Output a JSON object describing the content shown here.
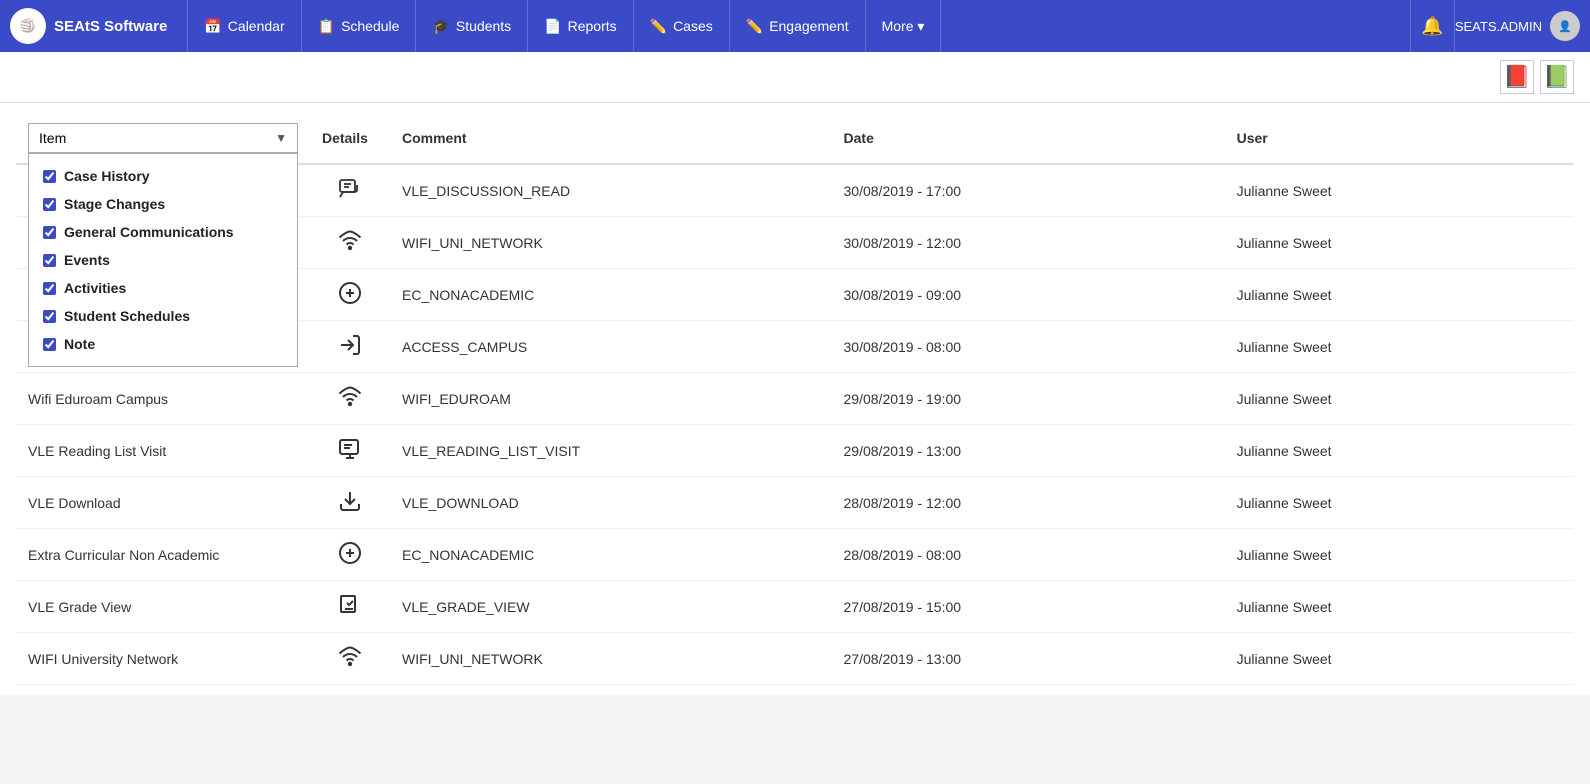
{
  "brand": {
    "logo_text": "SEAtS",
    "name": "SEAtS Software"
  },
  "nav": {
    "items": [
      {
        "label": "Calendar",
        "icon": "📅"
      },
      {
        "label": "Schedule",
        "icon": "📋"
      },
      {
        "label": "Students",
        "icon": "🎓"
      },
      {
        "label": "Reports",
        "icon": "📄"
      },
      {
        "label": "Cases",
        "icon": "✏️"
      },
      {
        "label": "Engagement",
        "icon": "✏️"
      },
      {
        "label": "More ▾",
        "icon": ""
      }
    ],
    "admin_label": "SEATS.ADMIN"
  },
  "toolbar": {
    "pdf_label": "PDF",
    "excel_label": "XLS"
  },
  "table": {
    "columns": {
      "item": "Item",
      "details": "Details",
      "comment": "Comment",
      "date": "Date",
      "user": "User"
    },
    "dropdown": {
      "label": "Item",
      "options": [
        {
          "label": "Case History",
          "checked": true
        },
        {
          "label": "Stage Changes",
          "checked": true
        },
        {
          "label": "General Communications",
          "checked": true
        },
        {
          "label": "Events",
          "checked": true
        },
        {
          "label": "Activities",
          "checked": true
        },
        {
          "label": "Student Schedules",
          "checked": true
        },
        {
          "label": "Note",
          "checked": true
        }
      ]
    },
    "rows": [
      {
        "item": "",
        "icon": "💬",
        "icon_name": "discussion-icon",
        "comment": "VLE_DISCUSSION_READ",
        "date": "30/08/2019 - 17:00",
        "user": "Julianne Sweet"
      },
      {
        "item": "",
        "icon": "📶",
        "icon_name": "wifi-icon",
        "comment": "WIFI_UNI_NETWORK",
        "date": "30/08/2019 - 12:00",
        "user": "Julianne Sweet"
      },
      {
        "item": "",
        "icon": "⊕",
        "icon_name": "add-circle-icon",
        "comment": "EC_NONACADEMIC",
        "date": "30/08/2019 - 09:00",
        "user": "Julianne Sweet"
      },
      {
        "item": "",
        "icon": "🚪",
        "icon_name": "access-icon",
        "comment": "ACCESS_CAMPUS",
        "date": "30/08/2019 - 08:00",
        "user": "Julianne Sweet"
      },
      {
        "item": "Wifi Eduroam Campus",
        "icon": "📶",
        "icon_name": "wifi-eduroam-icon",
        "comment": "WIFI_EDUROAM",
        "date": "29/08/2019 - 19:00",
        "user": "Julianne Sweet"
      },
      {
        "item": "VLE Reading List Visit",
        "icon": "📺",
        "icon_name": "reading-list-icon",
        "comment": "VLE_READING_LIST_VISIT",
        "date": "29/08/2019 - 13:00",
        "user": "Julianne Sweet"
      },
      {
        "item": "VLE Download",
        "icon": "⬇",
        "icon_name": "download-icon",
        "comment": "VLE_DOWNLOAD",
        "date": "28/08/2019 - 12:00",
        "user": "Julianne Sweet"
      },
      {
        "item": "Extra Curricular Non Academic",
        "icon": "⊕",
        "icon_name": "ec-icon",
        "comment": "EC_NONACADEMIC",
        "date": "28/08/2019 - 08:00",
        "user": "Julianne Sweet"
      },
      {
        "item": "VLE Grade View",
        "icon": "📋",
        "icon_name": "grade-icon",
        "comment": "VLE_GRADE_VIEW",
        "date": "27/08/2019 - 15:00",
        "user": "Julianne Sweet"
      },
      {
        "item": "WIFI University Network",
        "icon": "📶",
        "icon_name": "wifi-uni-icon",
        "comment": "WIFI_UNI_NETWORK",
        "date": "27/08/2019 - 13:00",
        "user": "Julianne Sweet"
      }
    ]
  }
}
